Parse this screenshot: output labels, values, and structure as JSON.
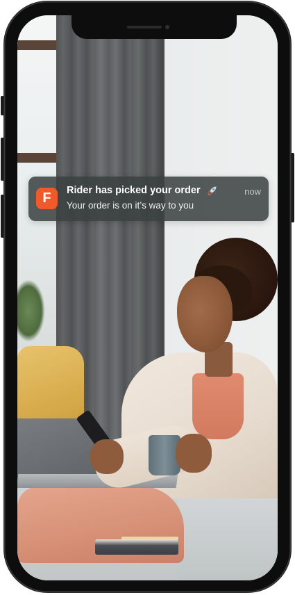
{
  "notification": {
    "app_icon_letter": "F",
    "title": "Rider has picked your order",
    "title_emoji_icon": "rocket-icon",
    "time": "now",
    "body": "Your order is on it’s way to you"
  },
  "colors": {
    "app_icon_bg": "#f05a2a",
    "notification_bg": "#3a4040",
    "device_frame": "#0d0d0d"
  }
}
